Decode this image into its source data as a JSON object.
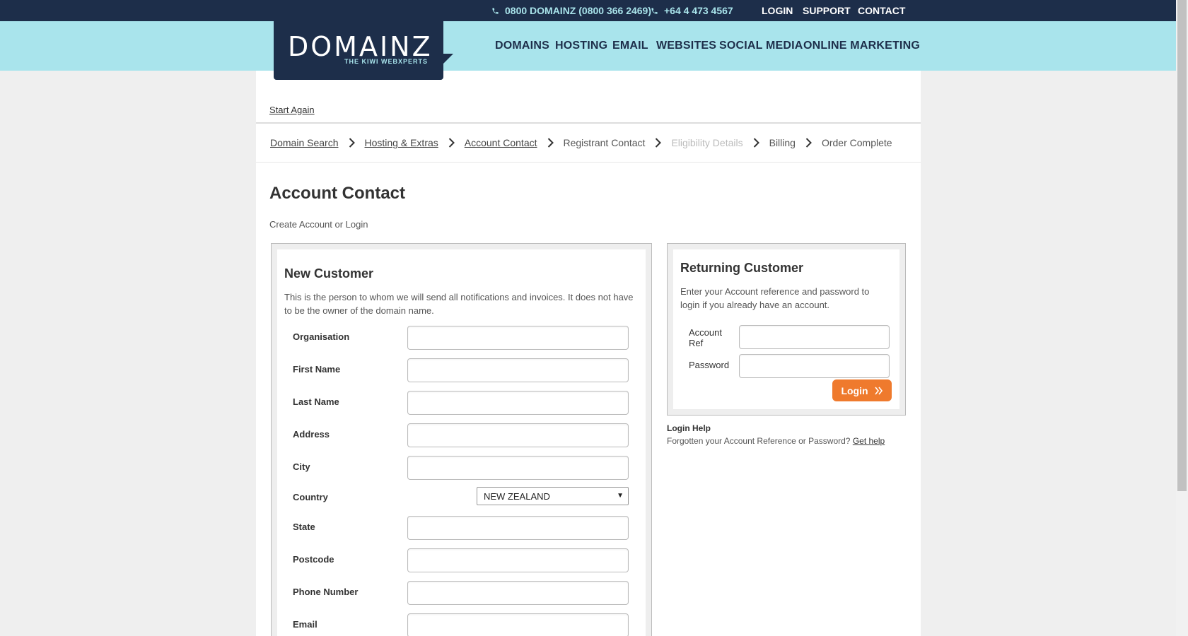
{
  "topbar": {
    "phone1": "0800 DOMAINZ (0800 366 2469)",
    "phone2": "+64 4 473 4567",
    "links": [
      "LOGIN",
      "SUPPORT",
      "CONTACT"
    ]
  },
  "logo": {
    "wordmark": "DOMAINZ",
    "tagline": "THE KIWI WEBXPERTS"
  },
  "nav": [
    "DOMAINS",
    "HOSTING",
    "EMAIL",
    "WEBSITES",
    "SOCIAL MEDIA",
    "ONLINE MARKETING"
  ],
  "start_again": "Start Again",
  "steps": [
    {
      "label": "Domain Search",
      "state": "link"
    },
    {
      "label": "Hosting & Extras",
      "state": "link"
    },
    {
      "label": "Account Contact",
      "state": "link"
    },
    {
      "label": "Registrant Contact",
      "state": "normal"
    },
    {
      "label": "Eligibility Details",
      "state": "disabled"
    },
    {
      "label": "Billing",
      "state": "normal"
    },
    {
      "label": "Order Complete",
      "state": "normal"
    }
  ],
  "page_title": "Account Contact",
  "subtitle": "Create Account or Login",
  "new_customer": {
    "title": "New Customer",
    "desc_line1": "This is the person to whom we will send all notifications and invoices. It does not have",
    "desc_line2": "to be the owner of the domain name.",
    "fields": {
      "organisation": "Organisation",
      "first_name": "First Name",
      "last_name": "Last Name",
      "address": "Address",
      "city": "City",
      "country": "Country",
      "state": "State",
      "postcode": "Postcode",
      "phone": "Phone Number",
      "email": "Email"
    },
    "country_value": "NEW ZEALAND"
  },
  "returning": {
    "title": "Returning Customer",
    "desc_line1": "Enter your Account reference and password to",
    "desc_line2": "login if you already have an account.",
    "account_ref_1": "Account",
    "account_ref_2": "Ref",
    "password": "Password",
    "login_button": "Login"
  },
  "login_help": {
    "title": "Login Help",
    "text": "Forgotten your Account Reference or Password?",
    "link": "Get help"
  },
  "colors": {
    "navy": "#1d2e4a",
    "aqua": "#a9e4ec",
    "orange": "#ef7a2d"
  }
}
